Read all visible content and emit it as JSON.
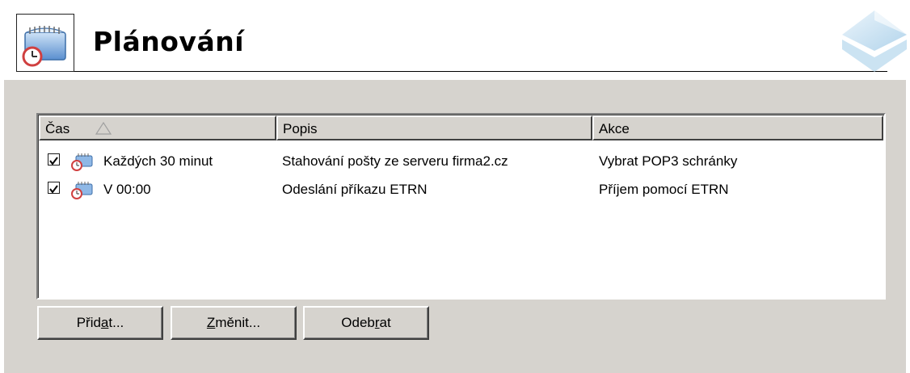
{
  "header": {
    "title": "Plánování",
    "icon": "calendar-clock-icon",
    "logo": "blue-diamond-logo"
  },
  "list": {
    "columns": [
      {
        "label": "Čas",
        "sort": "ascending"
      },
      {
        "label": "Popis"
      },
      {
        "label": "Akce"
      }
    ],
    "rows": [
      {
        "checked": true,
        "icon": "scheduled-event-icon",
        "time": "Každých 30 minut",
        "description": "Stahování pošty ze serveru firma2.cz",
        "action": "Vybrat POP3 schránky"
      },
      {
        "checked": true,
        "icon": "scheduled-event-icon",
        "time": "V 00:00",
        "description": "Odeslání příkazu ETRN",
        "action": "Příjem pomocí ETRN"
      }
    ]
  },
  "buttons": {
    "add_before": "Přid",
    "add_mnemonic": "a",
    "add_after": "t...",
    "edit_before": "",
    "edit_mnemonic": "Z",
    "edit_after": "měnit...",
    "remove_before": "Odeb",
    "remove_mnemonic": "r",
    "remove_after": "at"
  },
  "colors": {
    "panel": "#d6d3ce",
    "icon_blue": "#4a7fc1",
    "clock_red": "#d04040"
  }
}
